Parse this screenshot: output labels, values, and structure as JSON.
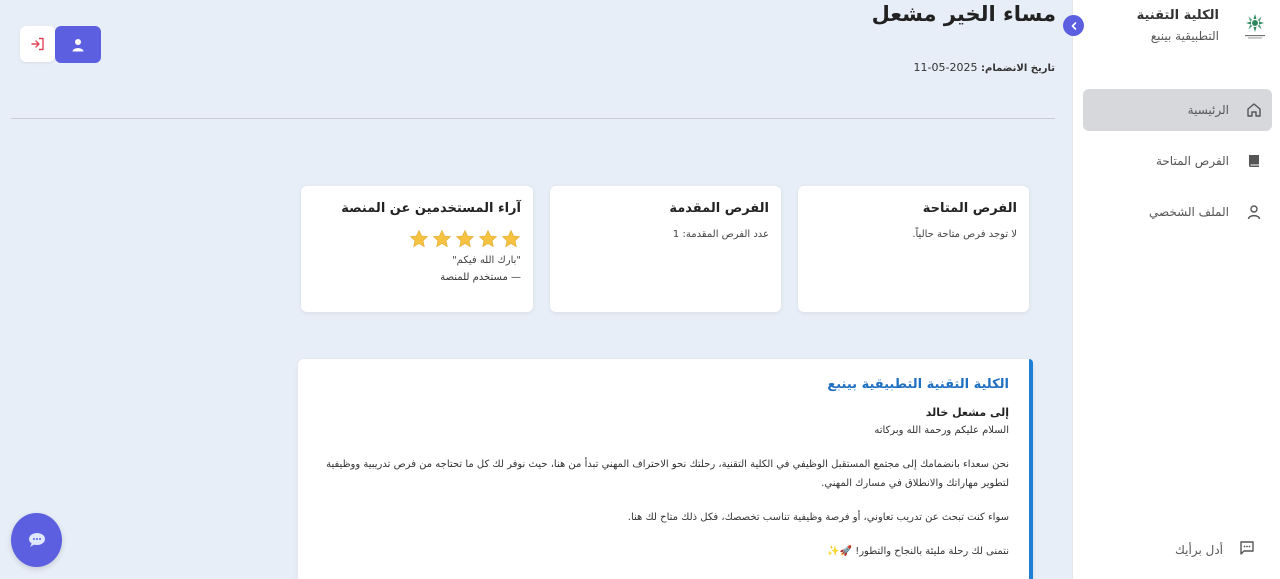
{
  "sidebar": {
    "brand_title": "الكلية التقنية",
    "brand_subtitle": "التطبيقية بينبع",
    "items": [
      {
        "label": "الرئيسية",
        "icon": "home-icon",
        "active": true
      },
      {
        "label": "الفرص المتاحة",
        "icon": "book-icon",
        "active": false
      },
      {
        "label": "الملف الشخصي",
        "icon": "user-icon",
        "active": false
      }
    ],
    "feedback_label": "أدل برأيك"
  },
  "header": {
    "greeting": "مساء الخير مشعل",
    "joined_label": "تاريخ الانضمام:",
    "joined_date": "2025-05-11"
  },
  "cards": {
    "available": {
      "title": "الفرص المتاحة",
      "text": "لا توجد فرص متاحة حالياً."
    },
    "applied": {
      "title": "الفرص المقدمة",
      "text": "عدد الفرص المقدمة: 1"
    },
    "reviews": {
      "title": "آراء المستخدمين عن المنصة",
      "rating": 5,
      "max_rating": 5,
      "quote": "\"بارك الله فيكم\"",
      "quote_by": "— مستخدم للمنصة"
    }
  },
  "letter": {
    "title": "الكلية التقنية التطبيقية بينبع",
    "to": "إلى مشعل خالد",
    "salutation": "السلام عليكم ورحمة الله وبركاته",
    "p1": "نحن سعداء بانضمامك إلى مجتمع المستقبل الوظيفي في الكلية التقنية، رحلتك نحو الاحتراف المهني تبدأ من هنا، حيث نوفر لك كل ما تحتاجه من فرص تدريبية ووظيفية لتطوير مهاراتك والانطلاق في مسارك المهني.",
    "p2": "سواء كنت تبحث عن تدريب تعاوني، أو فرصة وظيفية تناسب تخصصك، فكل ذلك متاح لك هنا.",
    "p3": "نتمنى لك رحلة مليئة بالنجاح والتطور! 🚀✨"
  },
  "colors": {
    "accent": "#5b5fe0",
    "letter_title": "#1f6fc2",
    "letter_border": "#1e7fd4",
    "star": "#f5c242",
    "page_bg": "#e8eef7"
  }
}
